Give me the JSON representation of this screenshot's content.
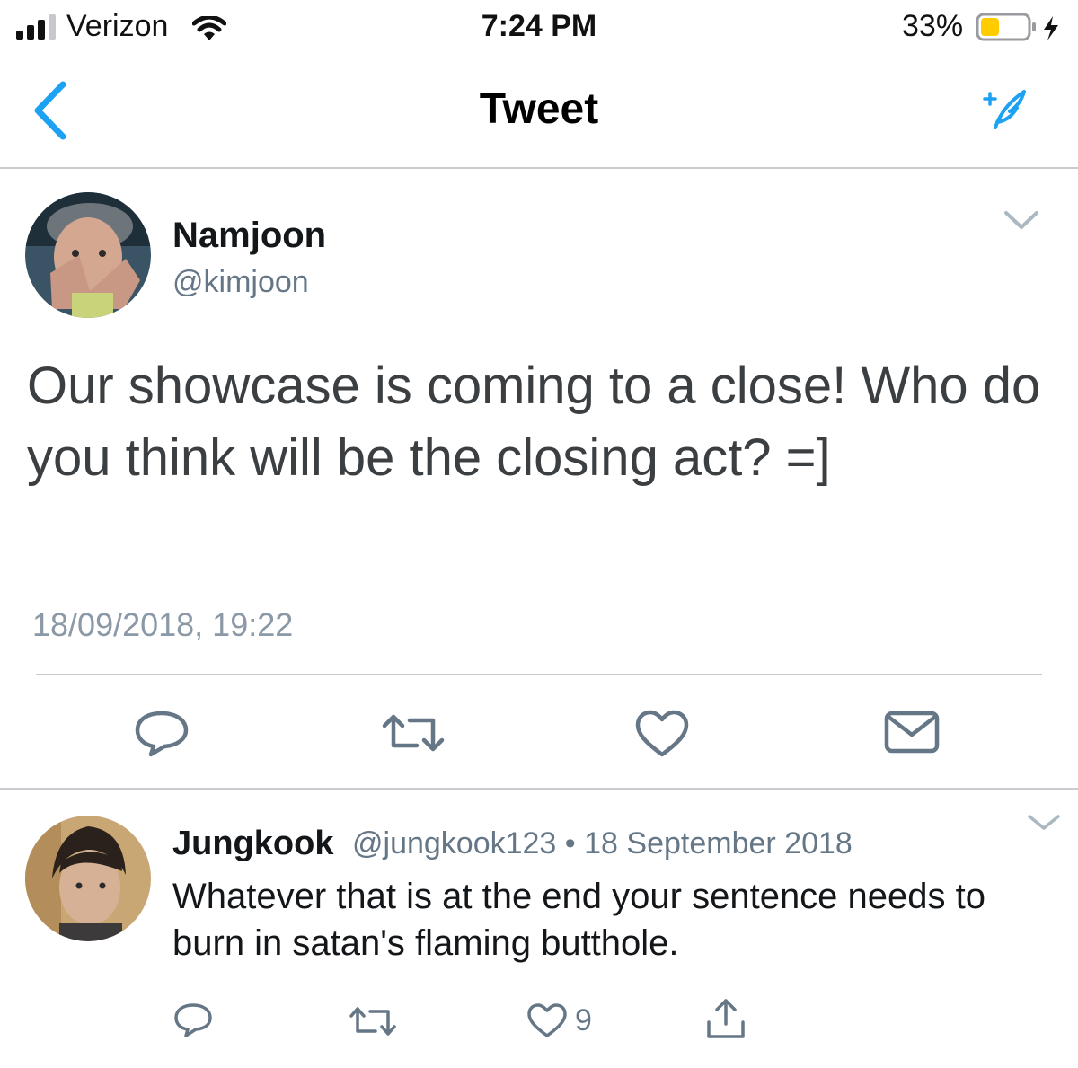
{
  "status_bar": {
    "carrier": "Verizon",
    "time": "7:24 PM",
    "battery_percent": "33%"
  },
  "nav": {
    "title": "Tweet",
    "back_icon": "chevron-left-icon",
    "compose_icon": "compose-feather-icon",
    "accent_color": "#1da1f2"
  },
  "tweet": {
    "author_name": "Namjoon",
    "author_handle": "@kimjoon",
    "text": "Our showcase is coming to a close! Who do you think will be the closing act? =]",
    "timestamp": "18/09/2018, 19:22",
    "actions": [
      "reply-icon",
      "retweet-icon",
      "like-icon",
      "message-icon"
    ]
  },
  "reply": {
    "author_name": "Jungkook",
    "meta": "@jungkook123 • 18 September 2018",
    "text": "Whatever that is at the end your sentence needs to burn in satan's flaming butthole.",
    "like_count": "9",
    "actions": [
      "reply-icon",
      "retweet-icon",
      "like-icon",
      "share-icon"
    ]
  }
}
